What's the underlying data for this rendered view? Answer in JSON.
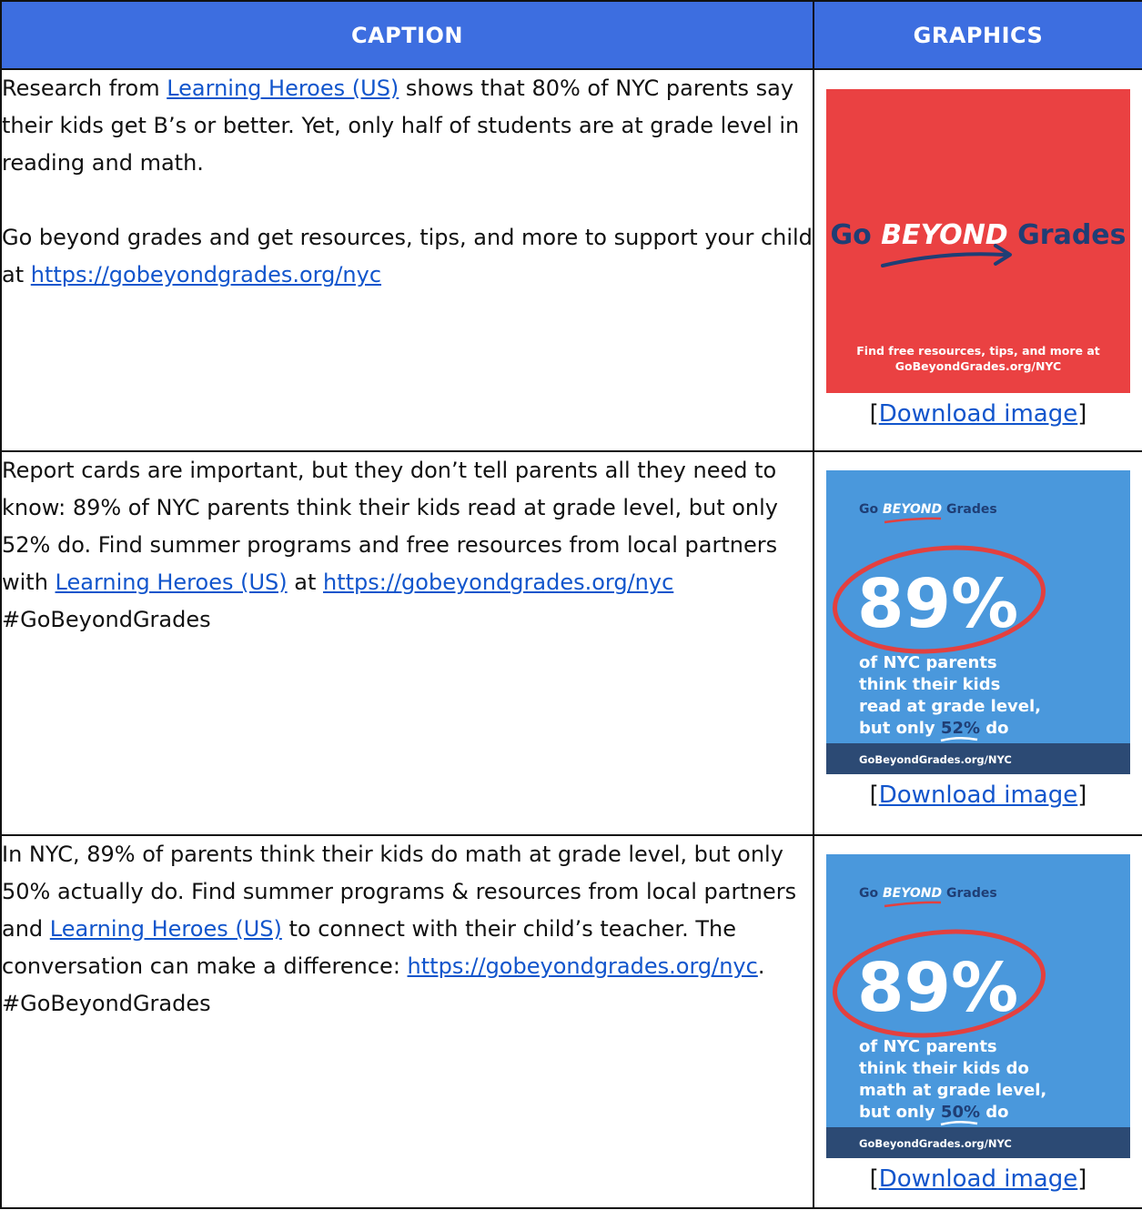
{
  "table": {
    "headers": [
      "CAPTION",
      "GRAPHICS"
    ],
    "rows": [
      {
        "caption": {
          "p1_a": "Research from ",
          "p1_link": "Learning Heroes (US)",
          "p1_b": " shows that 80% of NYC parents say their kids get B’s or better. Yet, only half of students are at grade level in reading and math.",
          "p2_a": "Go beyond grades and get resources, tips, and more to support your child at ",
          "p2_link": "https://gobeyondgrades.org/nyc",
          "p2_b": ""
        },
        "graphic": {
          "brand_go": "Go",
          "brand_beyond": "BEYOND",
          "brand_grades": "Grades",
          "footer_line1": "Find free resources, tips, and more at",
          "footer_line2": "GoBeyondGrades.org/NYC",
          "bg_color": "#ea4142",
          "text_color": "#1f3e75"
        },
        "download": {
          "open": "[",
          "label": "Download image",
          "close": "]"
        }
      },
      {
        "caption": {
          "p1_a": "Report cards are important, but they don’t tell parents all they need to know: 89% of NYC parents think their kids read at grade level, but only 52% do. Find summer programs and free resources from local partners with ",
          "p1_link": "Learning Heroes (US)",
          "p1_b": " at ",
          "p1_link2": "https://gobeyondgrades.org/nyc",
          "p1_c": " #GoBeyondGrades"
        },
        "graphic": {
          "brand_go": "Go",
          "brand_beyond": "BEYOND",
          "brand_grades": "Grades",
          "big_stat": "89%",
          "line1": "of NYC parents",
          "line2": "think their kids",
          "line3": "read at grade level,",
          "line4_a": "but only ",
          "line4_stat": "52%",
          "line4_b": " do",
          "footer": "GoBeyondGrades.org/NYC",
          "bg_color": "#4a98dc",
          "footer_color": "#2c4a74"
        },
        "download": {
          "open": "[",
          "label": "Download image",
          "close": "]"
        }
      },
      {
        "caption": {
          "p1_a": "In NYC, 89% of parents think their kids do math at grade level, but only 50% actually do. Find summer programs & resources from local partners and ",
          "p1_link": "Learning Heroes (US)",
          "p1_b": " to connect with their child’s teacher. The conversation can make a difference: ",
          "p1_link2": "https://gobeyondgrades.org/nyc",
          "p1_c": ". #GoBeyondGrades"
        },
        "graphic": {
          "brand_go": "Go",
          "brand_beyond": "BEYOND",
          "brand_grades": "Grades",
          "big_stat": "89%",
          "line1": "of NYC parents",
          "line2": "think their kids do",
          "line3": "math at grade level,",
          "line4_a": "but only ",
          "line4_stat": "50%",
          "line4_b": " do",
          "footer": "GoBeyondGrades.org/NYC",
          "bg_color": "#4a98dc",
          "footer_color": "#2c4a74"
        },
        "download": {
          "open": "[",
          "label": "Download image",
          "close": "]"
        }
      }
    ]
  }
}
